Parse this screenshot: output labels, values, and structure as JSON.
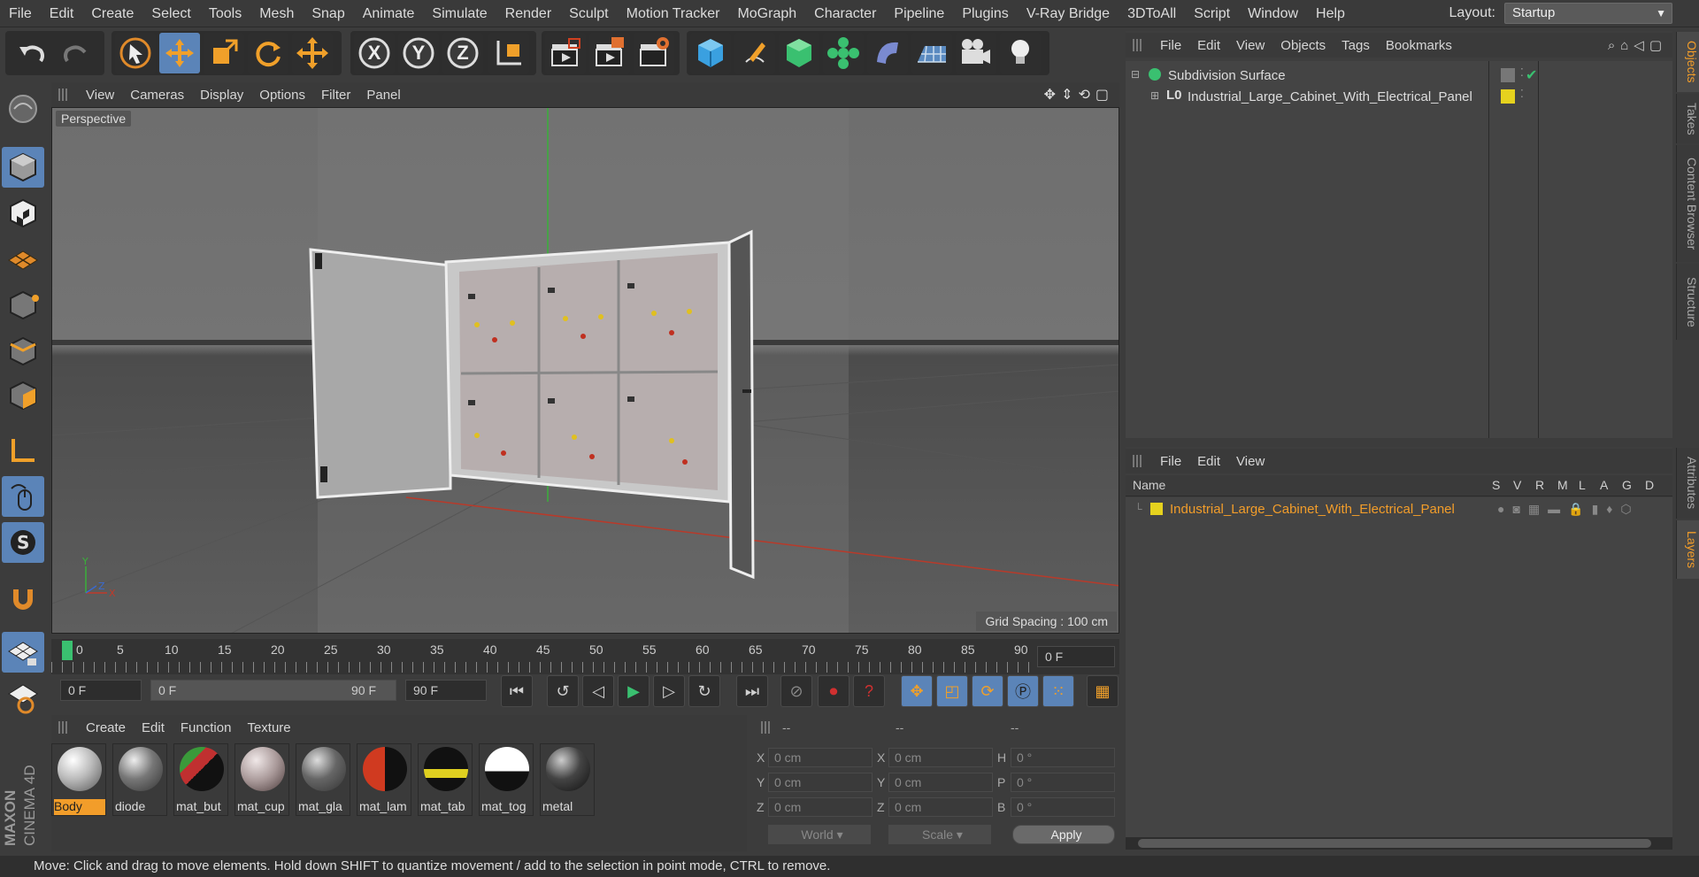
{
  "menu": [
    "File",
    "Edit",
    "Create",
    "Select",
    "Tools",
    "Mesh",
    "Snap",
    "Animate",
    "Simulate",
    "Render",
    "Sculpt",
    "Motion Tracker",
    "MoGraph",
    "Character",
    "Pipeline",
    "Plugins",
    "V-Ray Bridge",
    "3DToAll",
    "Script",
    "Window",
    "Help"
  ],
  "layout": {
    "label": "Layout:",
    "value": "Startup"
  },
  "axes": {
    "x": "X",
    "y": "Y",
    "z": "Z"
  },
  "viewport": {
    "menu": [
      "View",
      "Cameras",
      "Display",
      "Options",
      "Filter",
      "Panel"
    ],
    "label": "Perspective",
    "grid_spacing": "Grid Spacing : 100 cm"
  },
  "timeline": {
    "ticks": [
      "0",
      "5",
      "10",
      "15",
      "20",
      "25",
      "30",
      "35",
      "40",
      "45",
      "50",
      "55",
      "60",
      "65",
      "70",
      "75",
      "80",
      "85",
      "90"
    ],
    "current_frame": "0 F",
    "start": "0 F",
    "range_start": "0 F",
    "range_end": "90 F",
    "end": "90 F"
  },
  "materials": {
    "menu": [
      "Create",
      "Edit",
      "Function",
      "Texture"
    ],
    "items": [
      "Body",
      "diode",
      "mat_but",
      "mat_cup",
      "mat_gla",
      "mat_lam",
      "mat_tab",
      "mat_tog",
      "metal"
    ]
  },
  "coords": {
    "headers": [
      "--",
      "--",
      "--"
    ],
    "rows": [
      {
        "a": "X",
        "av": "0 cm",
        "b": "X",
        "bv": "0 cm",
        "c": "H",
        "cv": "0 °"
      },
      {
        "a": "Y",
        "av": "0 cm",
        "b": "Y",
        "bv": "0 cm",
        "c": "P",
        "cv": "0 °"
      },
      {
        "a": "Z",
        "av": "0 cm",
        "b": "Z",
        "bv": "0 cm",
        "c": "B",
        "cv": "0 °"
      }
    ],
    "world": "World",
    "scale": "Scale",
    "apply": "Apply"
  },
  "objects": {
    "menu": [
      "File",
      "Edit",
      "View",
      "Objects",
      "Tags",
      "Bookmarks"
    ],
    "items": [
      "Subdivision Surface",
      "Industrial_Large_Cabinet_With_Electrical_Panel"
    ]
  },
  "layers": {
    "menu": [
      "File",
      "Edit",
      "View"
    ],
    "name_header": "Name",
    "cols": [
      "S",
      "V",
      "R",
      "M",
      "L",
      "A",
      "G",
      "D"
    ],
    "item": "Industrial_Large_Cabinet_With_Electrical_Panel"
  },
  "side_tabs": {
    "top": [
      "Objects",
      "Takes",
      "Content Browser",
      "Structure"
    ],
    "bottom": [
      "Attributes",
      "Layers"
    ]
  },
  "status": "Move: Click and drag to move elements. Hold down SHIFT to quantize movement / add to the selection in point mode, CTRL to remove.",
  "branding": {
    "maxon": "MAXON",
    "cinema": "CINEMA 4D"
  },
  "colors": {
    "accent": "#f29d2a",
    "selected_blue": "#5b84b8",
    "layer_yellow": "#e6d21e"
  }
}
